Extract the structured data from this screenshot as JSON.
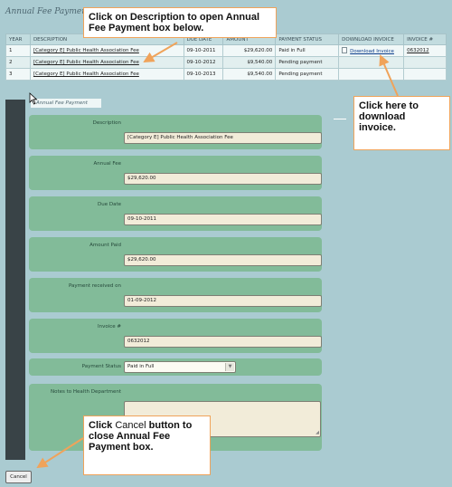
{
  "page_title": "Annual Fee Payment",
  "table": {
    "headers": [
      "YEAR",
      "DESCRIPTION",
      "DUE DATE",
      "AMOUNT",
      "PAYMENT STATUS",
      "DOWNLOAD INVOICE",
      "INVOICE #"
    ],
    "rows": [
      {
        "year": "1",
        "description": "[Category E] Public Health Association Fee",
        "due_date": "09-10-2011",
        "amount": "$29,620.00",
        "status": "Paid in Full",
        "download": "Download Invoice",
        "invoice": "0632012"
      },
      {
        "year": "2",
        "description": "[Category E] Public Health Association Fee",
        "due_date": "09-10-2012",
        "amount": "$9,540.00",
        "status": "Pending payment",
        "download": "",
        "invoice": ""
      },
      {
        "year": "3",
        "description": "[Category E] Public Health Association Fee",
        "due_date": "09-10-2013",
        "amount": "$9,540.00",
        "status": "Pending payment",
        "download": "",
        "invoice": ""
      }
    ]
  },
  "form": {
    "legend": "Annual Fee Payment",
    "description_label": "Description",
    "description_value": "[Category E] Public Health Association Fee",
    "annual_fee_label": "Annual Fee",
    "annual_fee_value": "$29,620.00",
    "due_date_label": "Due Date",
    "due_date_value": "09-10-2011",
    "amount_paid_label": "Amount Paid",
    "amount_paid_value": "$29,620.00",
    "payment_received_label": "Payment received on",
    "payment_received_value": "01-09-2012",
    "invoice_label": "Invoice #",
    "invoice_value": "0632012",
    "payment_status_label": "Payment Status",
    "payment_status_value": "Paid in Full",
    "notes_label": "Notes to Health Department",
    "cancel_label": "Cancel"
  },
  "callouts": {
    "description": "Click on Description to open Annual Fee Payment box below.",
    "download": "Click here to download invoice.",
    "cancel_prefix": "Click ",
    "cancel_word": "Cancel",
    "cancel_suffix": " button to close Annual Fee Payment box."
  },
  "colors": {
    "background": "#aacbd1",
    "field_row": "#82bb99",
    "callout_border": "#f0a35a",
    "arrow": "#f0a35a"
  }
}
